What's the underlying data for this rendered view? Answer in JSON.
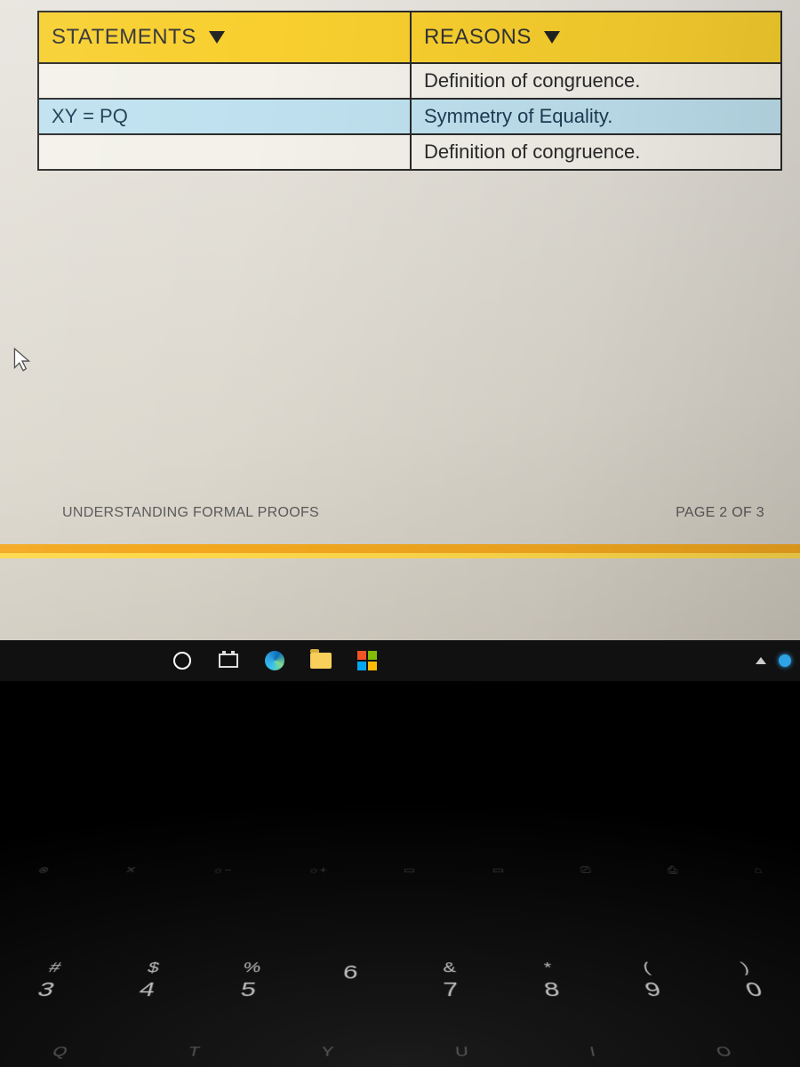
{
  "table": {
    "header": {
      "statements": "STATEMENTS",
      "reasons": "REASONS"
    },
    "rows": [
      {
        "statement": "",
        "reason": "Definition of congruence."
      },
      {
        "statement": "XY = PQ",
        "reason": "Symmetry of Equality."
      },
      {
        "statement": "",
        "reason": "Definition of congruence."
      }
    ]
  },
  "footer": {
    "title": "UNDERSTANDING FORMAL PROOFS",
    "page": "PAGE 2 OF 3"
  },
  "taskbar": {
    "items": [
      "cortana",
      "task-view",
      "edge",
      "file-explorer",
      "microsoft-store"
    ]
  },
  "keyboard": {
    "numrow": [
      {
        "sym": "#",
        "num": "3"
      },
      {
        "sym": "$",
        "num": "4"
      },
      {
        "sym": "%",
        "num": "5"
      },
      {
        "sym": "",
        "num": "6"
      },
      {
        "sym": "&",
        "num": "7"
      },
      {
        "sym": "*",
        "num": "8"
      },
      {
        "sym": "(",
        "num": "9"
      },
      {
        "sym": ")",
        "num": "0"
      }
    ]
  }
}
